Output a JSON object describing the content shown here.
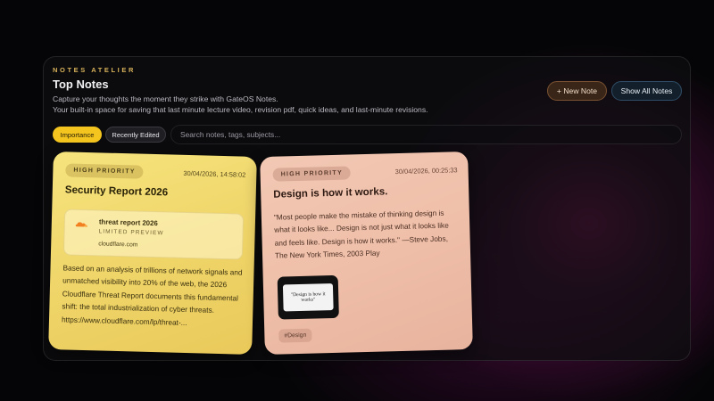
{
  "header": {
    "kicker": "NOTES ATELIER",
    "title": "Top Notes",
    "description_line1": "Capture your thoughts the moment they strike with GateOS Notes.",
    "description_line2": "Your built-in space for saving that last minute lecture video, revision pdf, quick ideas, and last-minute revisions.",
    "new_note_label": "+ New Note",
    "show_all_label": "Show All Notes"
  },
  "filters": {
    "chips": [
      {
        "label": "Importance",
        "active": true
      },
      {
        "label": "Recently Edited",
        "active": false
      }
    ],
    "search_placeholder": "Search notes, tags, subjects..."
  },
  "notes": [
    {
      "priority": "HIGH PRIORITY",
      "timestamp": "30/04/2026, 14:58:02",
      "title": "Security Report 2026",
      "preview": {
        "title": "threat report 2026",
        "kind": "LIMITED PREVIEW",
        "domain": "cloudflare.com",
        "icon": "cloudflare-logo"
      },
      "body": "Based on an analysis of trillions of network signals and unmatched visibility into 20% of the web, the 2026 Cloudflare Threat Report documents this fundamental shift: the total industrialization of cyber threats. https://www.cloudflare.com/lp/threat-...",
      "color": "#f6e47d"
    },
    {
      "priority": "HIGH PRIORITY",
      "timestamp": "30/04/2026, 00:25:33",
      "title": "Design is how it works.",
      "body": "\"Most people make the mistake of thinking design is what it looks like... Design is not just what it looks like and feels like. Design is how it works.\" —Steve Jobs, The New York Times, 2003 Play",
      "thumbnail": {
        "logo": "",
        "text": "\"Design is how it works\""
      },
      "tag": "#Design",
      "color": "#f2c8b4"
    }
  ],
  "colors": {
    "accent_yellow": "#f4c51f",
    "kicker_gold": "#d8b25a",
    "background": "#050507"
  }
}
